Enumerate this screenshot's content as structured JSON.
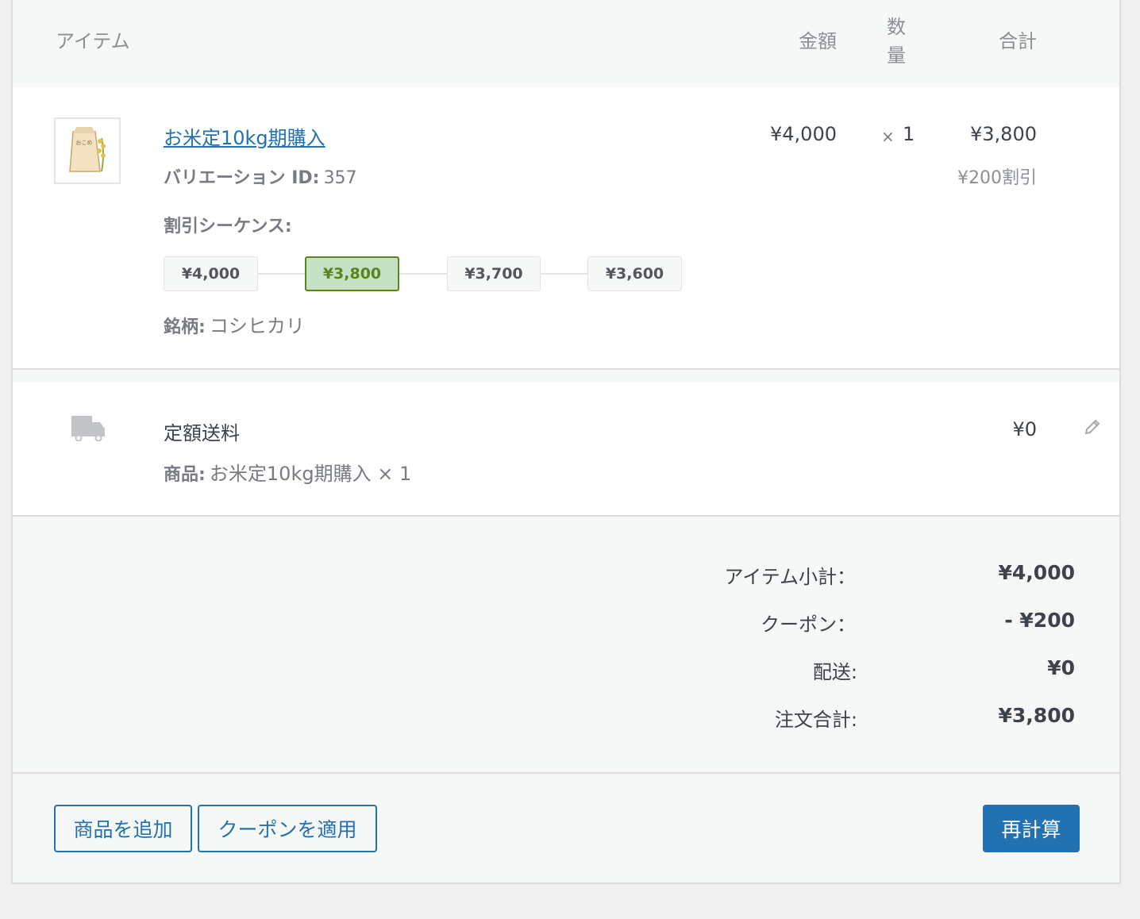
{
  "columns": {
    "item": "アイテム",
    "cost": "金額",
    "qty_line1": "数",
    "qty_line2": "量",
    "total": "合計"
  },
  "line_item": {
    "name": "お米定10kg期購入",
    "image_text": "おこめ",
    "variation_label": "バリエーション ID:",
    "variation_id": "357",
    "sequence_label": "割引シーケンス:",
    "sequence": [
      "¥4,000",
      "¥3,800",
      "¥3,700",
      "¥3,600"
    ],
    "brand_label": "銘柄:",
    "brand_value": "コシヒカリ",
    "cost": "¥4,000",
    "qty_x": "×",
    "qty": "1",
    "total": "¥3,800",
    "discount": "¥200割引"
  },
  "shipping": {
    "icon": "truck-icon",
    "name": "定額送料",
    "items_label": "商品:",
    "items_value": "お米定10kg期購入 × 1",
    "total": "¥0"
  },
  "totals": {
    "subtotal_label": "アイテム小計：",
    "subtotal": "¥4,000",
    "coupon_label": "クーポン：",
    "coupon": "- ¥200",
    "shipping_label": "配送:",
    "shipping": "¥0",
    "order_total_label": "注文合計:",
    "order_total": "¥3,800"
  },
  "actions": {
    "add_item": "商品を追加",
    "apply_coupon": "クーポンを適用",
    "recalculate": "再計算"
  },
  "colors": {
    "link": "#2271b1",
    "active_chip_bg": "#c6e1c6",
    "active_chip_text": "#5b841b"
  }
}
